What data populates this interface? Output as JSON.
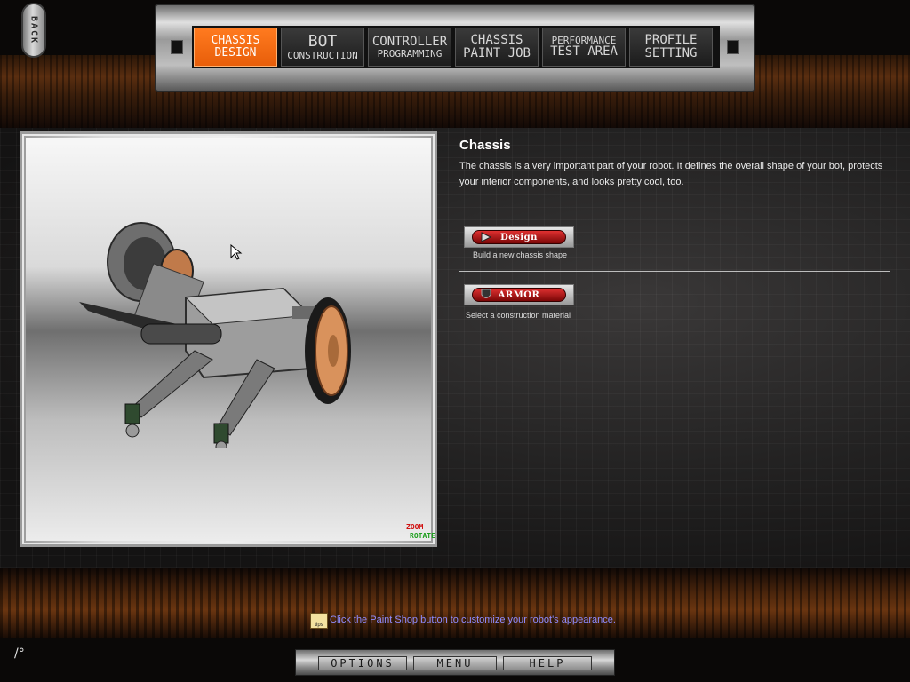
{
  "back_button": {
    "label": "BACK"
  },
  "nav": {
    "tabs": [
      {
        "line1": "CHASSIS",
        "line2": "DESIGN",
        "active": true
      },
      {
        "line1": "BOT",
        "line2": "CONSTRUCTION",
        "active": false
      },
      {
        "line1": "CONTROLLER",
        "line2": "PROGRAMMING",
        "active": false
      },
      {
        "line1": "CHASSIS",
        "line2": "PAINT JOB",
        "active": false
      },
      {
        "line1": "PERFORMANCE",
        "line2": "TEST AREA",
        "active": false
      },
      {
        "line1": "PROFILE",
        "line2": "SETTING",
        "active": false
      }
    ]
  },
  "viewer": {
    "zoom_label": "ZOOM",
    "rotate_label": "ROTATE"
  },
  "info": {
    "title": "Chassis",
    "description": "The chassis is a very important part of your robot. It defines the overall shape of your bot, protects your interior components, and looks pretty cool, too."
  },
  "actions": {
    "design": {
      "label": "Design",
      "caption": "Build a new chassis shape"
    },
    "armor": {
      "label": "Armor",
      "caption": "Select a construction material"
    }
  },
  "tip": {
    "icon_label": "tips",
    "text": "Click the Paint Shop button to customize your robot's appearance."
  },
  "bottom_menu": {
    "options": "OPTIONS",
    "menu": "MENU",
    "help": "HELP"
  },
  "logo_text": "/°",
  "colors": {
    "active_tab": "#f26a12",
    "tip_text": "#8f8cff",
    "button_red": "#b01010"
  }
}
